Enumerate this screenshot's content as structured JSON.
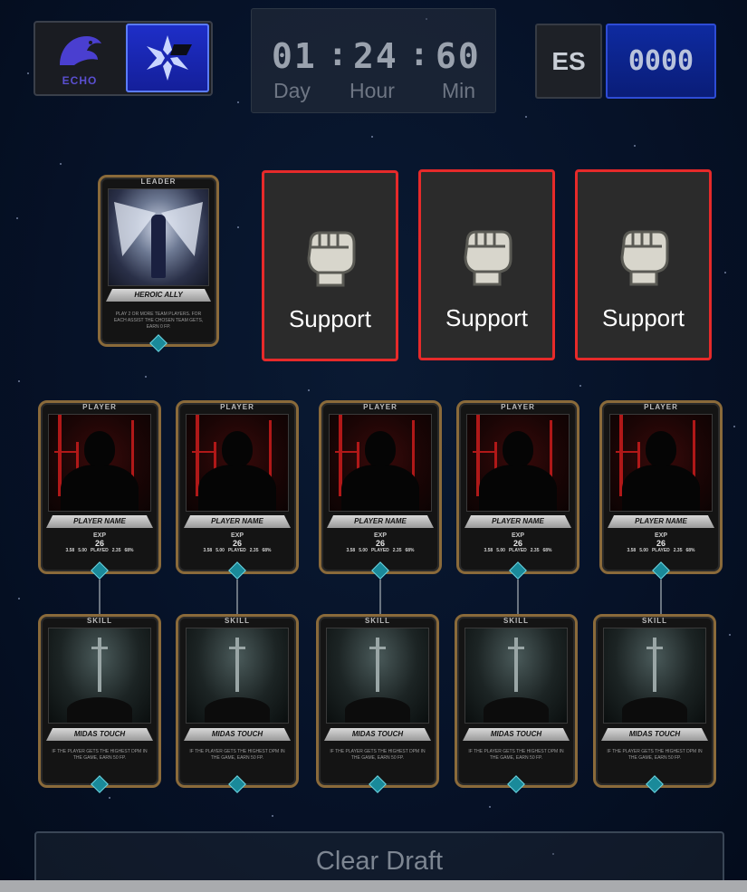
{
  "header": {
    "team_a_logo_text": "ECHO",
    "timer": {
      "days": "01",
      "hours": "24",
      "minutes": "60",
      "separator": ":",
      "day_label": "Day",
      "hour_label": "Hour",
      "minute_label": "Min"
    },
    "currency_label": "ES",
    "currency_value": "0000"
  },
  "leader_card": {
    "header": "LEADER",
    "name": "HEROIC ALLY",
    "description": "PLAY 2 OR MORE TEAM PLAYERS. FOR EACH ASSIST THE CHOSEN TEAM GETS, EARN 0 FP."
  },
  "support_slots": [
    {
      "label": "Support",
      "icon": "fist-icon"
    },
    {
      "label": "Support",
      "icon": "fist-icon"
    },
    {
      "label": "Support",
      "icon": "fist-icon"
    }
  ],
  "player_cards": [
    {
      "header": "PLAYER",
      "name": "PLAYER NAME",
      "exp_label": "EXP",
      "exp_value": "26",
      "stat_label": "PLAYED",
      "stats": [
        "3.58",
        "5.00",
        "2.35",
        "68%"
      ]
    },
    {
      "header": "PLAYER",
      "name": "PLAYER NAME",
      "exp_label": "EXP",
      "exp_value": "26",
      "stat_label": "PLAYED",
      "stats": [
        "3.58",
        "5.00",
        "2.35",
        "68%"
      ]
    },
    {
      "header": "PLAYER",
      "name": "PLAYER NAME",
      "exp_label": "EXP",
      "exp_value": "26",
      "stat_label": "PLAYED",
      "stats": [
        "3.58",
        "5.00",
        "2.35",
        "68%"
      ]
    },
    {
      "header": "PLAYER",
      "name": "PLAYER NAME",
      "exp_label": "EXP",
      "exp_value": "26",
      "stat_label": "PLAYED",
      "stats": [
        "3.58",
        "5.00",
        "2.35",
        "68%"
      ]
    },
    {
      "header": "PLAYER",
      "name": "PLAYER NAME",
      "exp_label": "EXP",
      "exp_value": "26",
      "stat_label": "PLAYED",
      "stats": [
        "3.58",
        "5.00",
        "2.35",
        "68%"
      ]
    }
  ],
  "skill_cards": [
    {
      "header": "SKILL",
      "name": "MIDAS TOUCH",
      "description": "IF THE PLAYER GETS THE HIGHEST DPM IN THE GAME, EARN 50 FP."
    },
    {
      "header": "SKILL",
      "name": "MIDAS TOUCH",
      "description": "IF THE PLAYER GETS THE HIGHEST DPM IN THE GAME, EARN 50 FP."
    },
    {
      "header": "SKILL",
      "name": "MIDAS TOUCH",
      "description": "IF THE PLAYER GETS THE HIGHEST DPM IN THE GAME, EARN 50 FP."
    },
    {
      "header": "SKILL",
      "name": "MIDAS TOUCH",
      "description": "IF THE PLAYER GETS THE HIGHEST DPM IN THE GAME, EARN 50 FP."
    },
    {
      "header": "SKILL",
      "name": "MIDAS TOUCH",
      "description": "IF THE PLAYER GETS THE HIGHEST DPM IN THE GAME, EARN 50 FP."
    }
  ],
  "actions": {
    "clear_label": "Clear Draft"
  },
  "colors": {
    "support_border": "#e62a2a",
    "score_blue": "#0e2aa0",
    "card_gold": "#8a6a3a",
    "gem_teal": "#1a8a9a"
  }
}
